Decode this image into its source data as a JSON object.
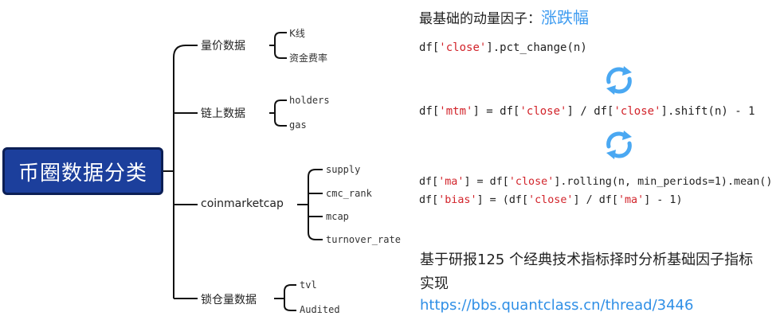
{
  "root": {
    "label": "币圈数据分类"
  },
  "branches": [
    {
      "label": "量价数据",
      "leaves": [
        "K线",
        "资金费率"
      ]
    },
    {
      "label": "链上数据",
      "leaves": [
        "holders",
        "gas"
      ]
    },
    {
      "label": "coinmarketcap",
      "leaves": [
        "supply",
        "cmc_rank",
        "mcap",
        "turnover_rate"
      ]
    },
    {
      "label": "锁仓量数据",
      "leaves": [
        "tvl",
        "Audited"
      ]
    }
  ],
  "panel": {
    "title_prefix": "最基础的动量因子：",
    "title_highlight": "涨跌幅",
    "code1": {
      "a": "df[",
      "s1": "'close'",
      "b": "].pct_change(n)"
    },
    "code2": {
      "a": "df[",
      "s1": "'mtm'",
      "b": "] = df[",
      "s2": "'close'",
      "c": "] / df[",
      "s3": "'close'",
      "d": "].shift(n) - 1"
    },
    "code3": {
      "a": "df[",
      "s1": "'ma'",
      "b": "] = df[",
      "s2": "'close'",
      "c": "].rolling(n, min_periods=1).mean()"
    },
    "code4": {
      "a": "df[",
      "s1": "'bias'",
      "b": "] = (df[",
      "s2": "'close'",
      "c": "] / df[",
      "s3": "'ma'",
      "d": "] - 1)"
    },
    "description": "基于研报125 个经典技术指标择时分析基础因子指标实现",
    "url": "https://bbs.quantclass.cn/thread/3446"
  },
  "colors": {
    "root_bg": "#1c3f9c",
    "accent": "#3d9bf0",
    "string": "#d2232a",
    "link": "#2f8fe6"
  },
  "icons": [
    "refresh-icon",
    "refresh-icon"
  ]
}
